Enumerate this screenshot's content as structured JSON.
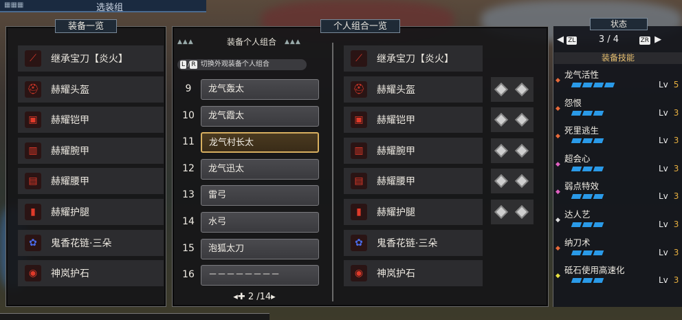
{
  "header": {
    "title": "选装组"
  },
  "left_panel": {
    "title": "装备一览",
    "items": [
      {
        "icon": "weapon-icon",
        "name": "继承宝刀【炎火】"
      },
      {
        "icon": "helmet-icon",
        "name": "赫耀头盔"
      },
      {
        "icon": "chest-icon",
        "name": "赫耀铠甲"
      },
      {
        "icon": "arm-icon",
        "name": "赫耀腕甲"
      },
      {
        "icon": "waist-icon",
        "name": "赫耀腰甲"
      },
      {
        "icon": "leg-icon",
        "name": "赫耀护腿"
      },
      {
        "icon": "talisman-icon",
        "name": "鬼香花链·三朵"
      },
      {
        "icon": "charm-icon",
        "name": "神岚护石"
      }
    ]
  },
  "sets_panel": {
    "title": "个人组合一览",
    "subtitle": "装备个人组合",
    "switch_hint": "切换外观装备个人组合",
    "key_l": "L",
    "key_r": "R",
    "sets": [
      {
        "num": "9",
        "name": "龙气轰太"
      },
      {
        "num": "10",
        "name": "龙气霞太"
      },
      {
        "num": "11",
        "name": "龙气村长太"
      },
      {
        "num": "12",
        "name": "龙气迅太"
      },
      {
        "num": "13",
        "name": "雷弓"
      },
      {
        "num": "14",
        "name": "水弓"
      },
      {
        "num": "15",
        "name": "泡狐太刀"
      },
      {
        "num": "16",
        "name": "－－－－－－－－"
      }
    ],
    "selected_index": 2,
    "pager": "◂✚ 2 /14▸",
    "preview": [
      "继承宝刀【炎火】",
      "赫耀头盔",
      "赫耀铠甲",
      "赫耀腕甲",
      "赫耀腰甲",
      "赫耀护腿",
      "鬼香花链·三朵",
      "神岚护石"
    ]
  },
  "status_panel": {
    "title": "状态",
    "zl": "ZL",
    "zr": "ZR",
    "page": "3 / 4",
    "skills_header": "装备技能",
    "skills": [
      {
        "name": "龙气活性",
        "bars": 4,
        "lv": "5",
        "color": "#e86a3a"
      },
      {
        "name": "怨恨",
        "bars": 3,
        "lv": "3",
        "color": "#e86a3a"
      },
      {
        "name": "死里逃生",
        "bars": 3,
        "lv": "3",
        "color": "#e86a3a"
      },
      {
        "name": "超会心",
        "bars": 3,
        "lv": "3",
        "color": "#e060c0"
      },
      {
        "name": "弱点特效",
        "bars": 3,
        "lv": "3",
        "color": "#e060c0"
      },
      {
        "name": "达人艺",
        "bars": 3,
        "lv": "3",
        "color": "#dddddd"
      },
      {
        "name": "纳刀术",
        "bars": 3,
        "lv": "3",
        "color": "#e86a3a"
      },
      {
        "name": "砥石使用高速化",
        "bars": 3,
        "lv": "3",
        "color": "#e8e040"
      }
    ],
    "lv_label": "Lv"
  },
  "colors": {
    "accent": "#d8b060",
    "bar": "#2a9ae8"
  }
}
